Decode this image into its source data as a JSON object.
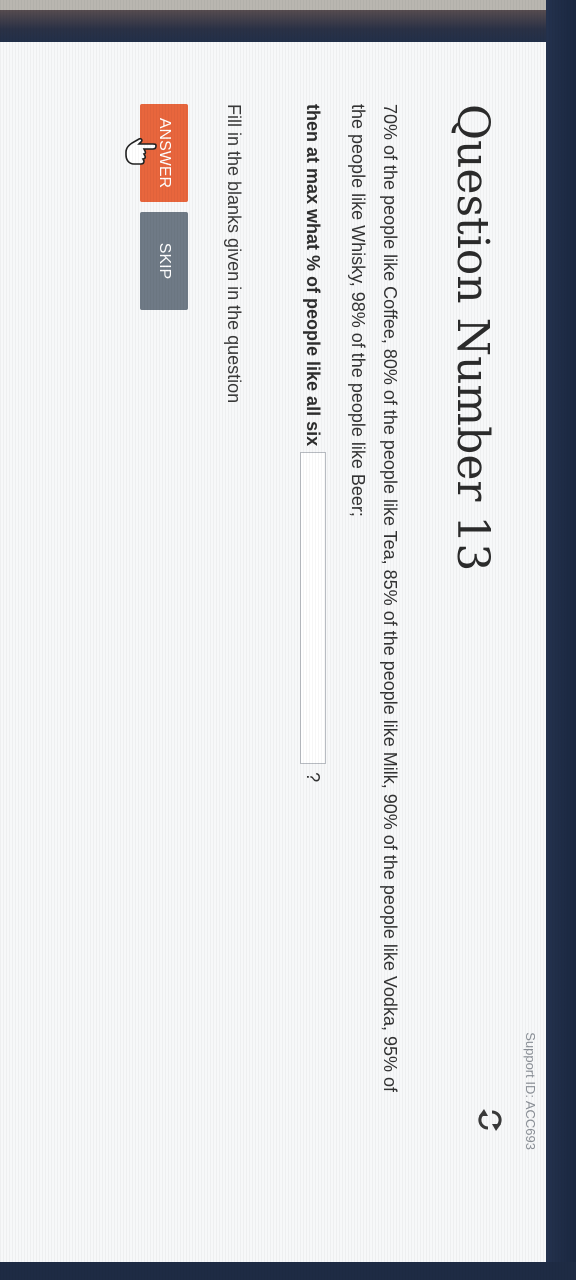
{
  "support_id": "Support ID: ACC693",
  "question": {
    "title": "Question Number 13",
    "text": "70% of the people like Coffee, 80% of the people like Tea, 85% of the people like Milk, 90% of the people like Vodka, 95% of the people like Whisky, 98% of the people like Beer;",
    "prompt": "then at max what % of people like all six",
    "blank_value": "",
    "question_mark": "?",
    "instruction": "Fill in the blanks given in the question"
  },
  "buttons": {
    "answer_label": "ANSWER",
    "skip_label": "SKIP"
  },
  "colors": {
    "answer": "#e8663d",
    "skip": "#6f7a86"
  },
  "icons": {
    "refresh": "refresh-icon",
    "cursor": "hand-cursor-icon"
  }
}
